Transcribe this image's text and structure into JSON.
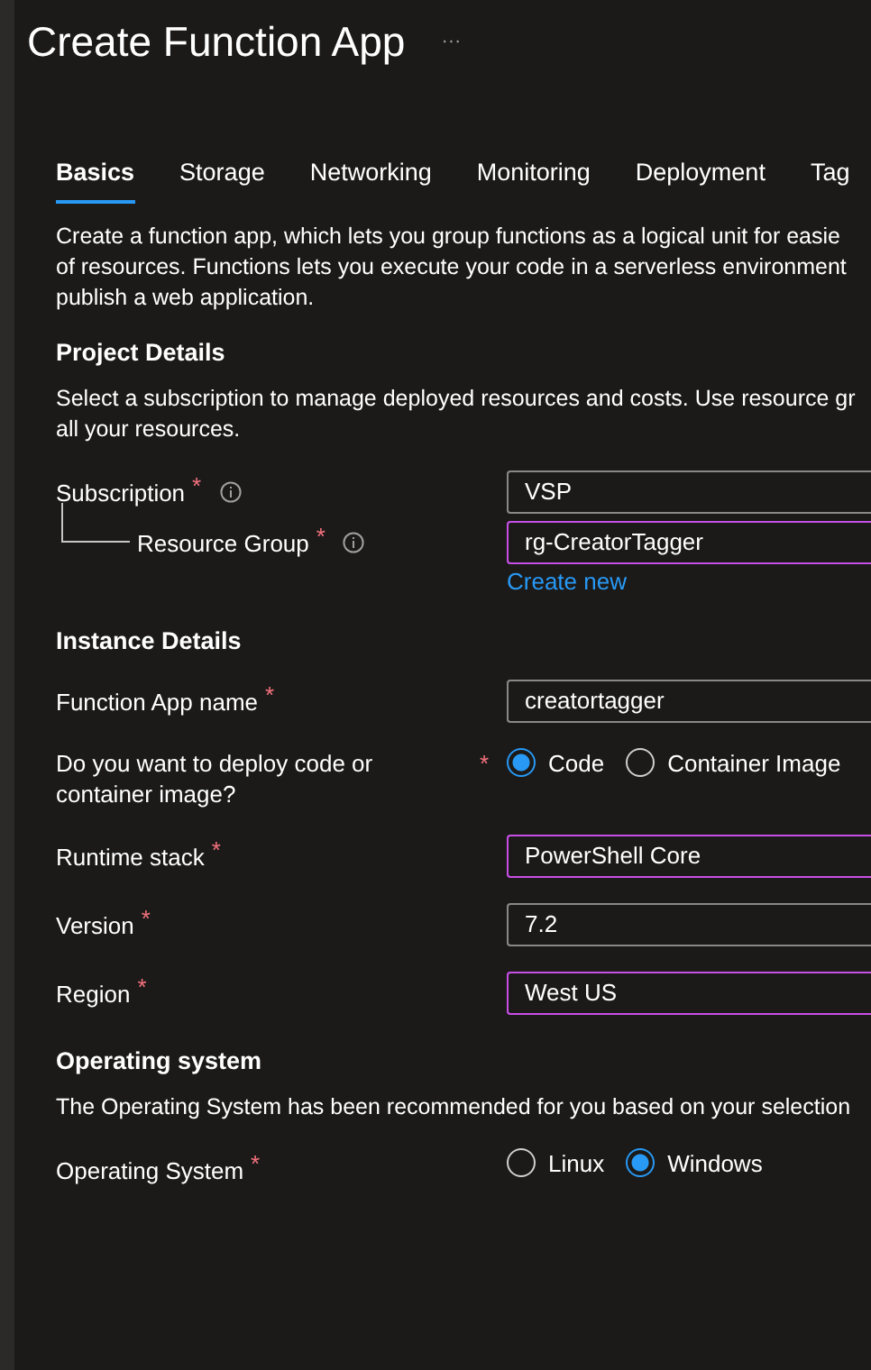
{
  "title": "Create Function App",
  "more": "···",
  "tabs": [
    {
      "label": "Basics",
      "selected": true
    },
    {
      "label": "Storage",
      "selected": false
    },
    {
      "label": "Networking",
      "selected": false
    },
    {
      "label": "Monitoring",
      "selected": false
    },
    {
      "label": "Deployment",
      "selected": false
    },
    {
      "label": "Tag",
      "selected": false
    }
  ],
  "intro": [
    "Create a function app, which lets you group functions as a logical unit for easie",
    "of resources. Functions lets you execute your code in a serverless environment",
    "publish a web application."
  ],
  "sections": [
    {
      "heading": "Project Details",
      "description": [
        "Select a subscription to manage deployed resources and costs. Use resource gr",
        "all your resources."
      ],
      "rows": [
        {
          "kind": "select",
          "label": "Subscription",
          "required_mark": "*",
          "info": true,
          "value": "VSP",
          "focused": false,
          "children": [
            {
              "kind": "select",
              "label": "Resource Group",
              "required_mark": "*",
              "info": true,
              "value": "rg-CreatorTagger",
              "focused": true,
              "link": "Create new"
            }
          ]
        }
      ]
    },
    {
      "heading": "Instance Details",
      "rows": [
        {
          "kind": "text",
          "label": "Function App name",
          "required_mark": "*",
          "value": "creatortagger",
          "focused": false
        },
        {
          "kind": "radio",
          "label": "Do you want to deploy code or container image?",
          "required_mark": "*",
          "options": [
            {
              "label": "Code",
              "selected": true
            },
            {
              "label": "Container Image",
              "selected": false
            }
          ]
        },
        {
          "kind": "select",
          "label": "Runtime stack",
          "required_mark": "*",
          "value": "PowerShell Core",
          "focused": true
        },
        {
          "kind": "select",
          "label": "Version",
          "required_mark": "*",
          "value": "7.2",
          "focused": false
        },
        {
          "kind": "select",
          "label": "Region",
          "required_mark": "*",
          "value": "West US",
          "focused": true
        }
      ]
    },
    {
      "heading": "Operating system",
      "description": [
        "The Operating System has been recommended for you based on your selection"
      ],
      "rows": [
        {
          "kind": "radio",
          "label": "Operating System",
          "required_mark": "*",
          "options": [
            {
              "label": "Linux",
              "selected": false
            },
            {
              "label": "Windows",
              "selected": true
            }
          ]
        }
      ]
    }
  ]
}
